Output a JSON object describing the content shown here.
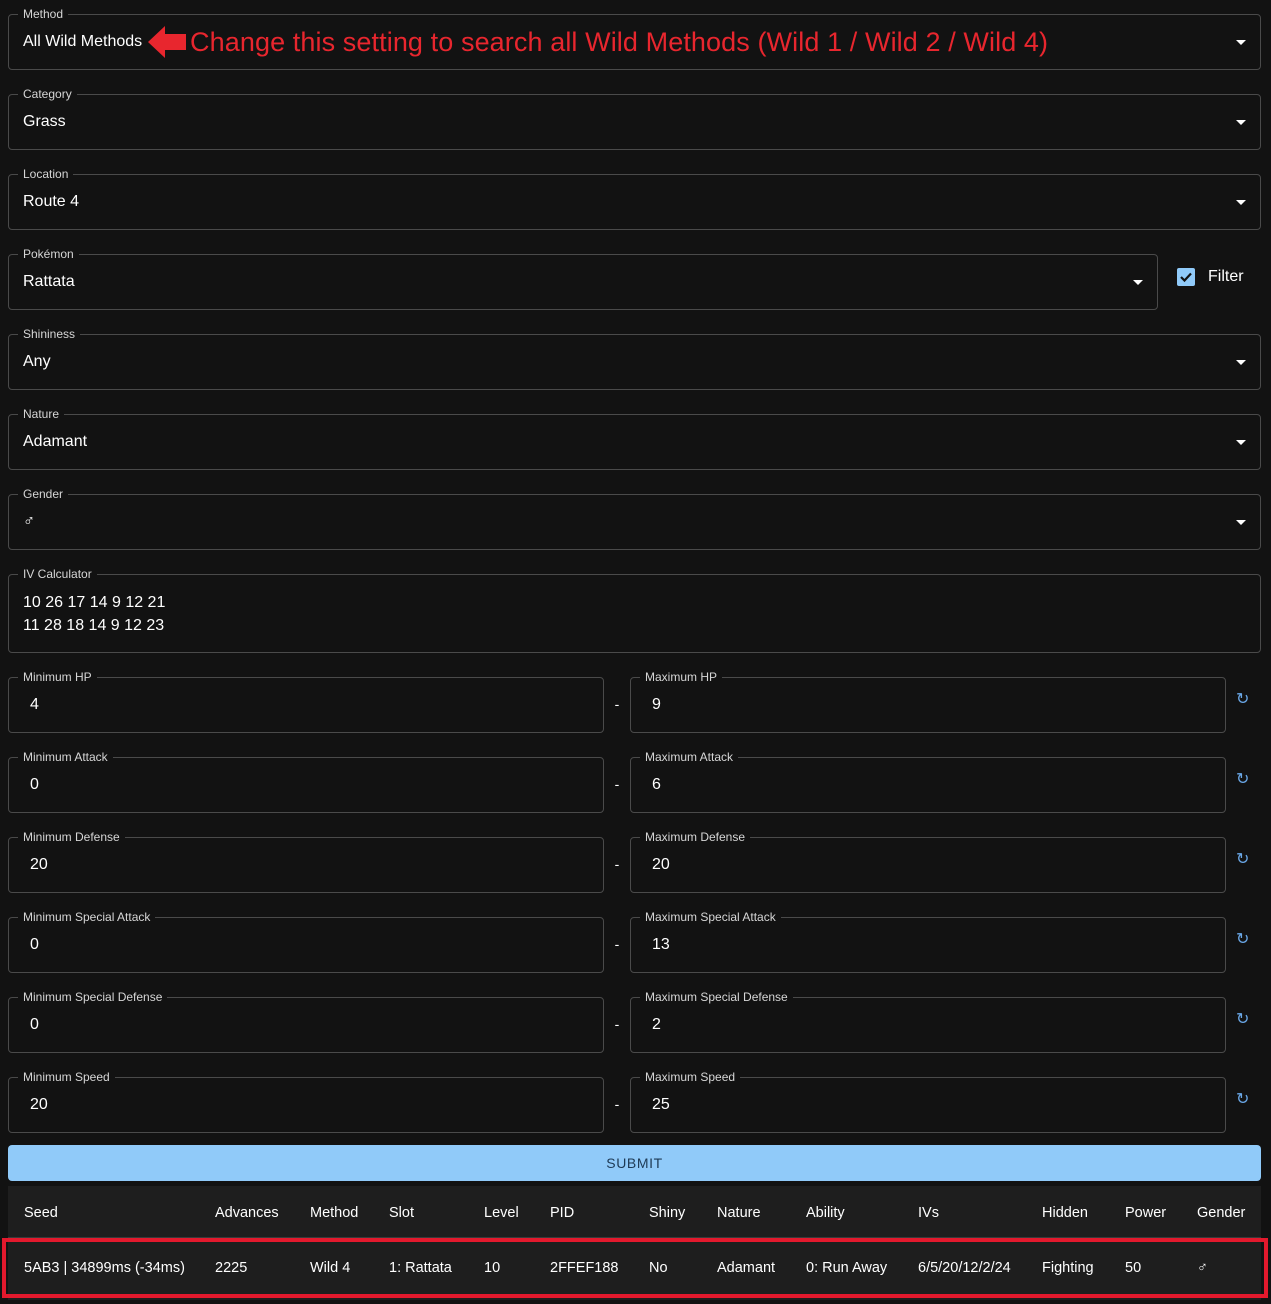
{
  "method": {
    "label": "Method",
    "value": "All Wild Methods"
  },
  "annotation": "Change this setting to search all Wild Methods (Wild 1 / Wild 2 / Wild 4)",
  "category": {
    "label": "Category",
    "value": "Grass"
  },
  "location": {
    "label": "Location",
    "value": "Route 4"
  },
  "pokemon": {
    "label": "Pokémon",
    "value": "Rattata"
  },
  "filter": {
    "label": "Filter",
    "checked": true
  },
  "shininess": {
    "label": "Shininess",
    "value": "Any"
  },
  "nature": {
    "label": "Nature",
    "value": "Adamant"
  },
  "gender": {
    "label": "Gender",
    "value": "♂"
  },
  "iv_calculator": {
    "label": "IV Calculator",
    "value": "10 26 17 14 9 12 21\n11 28 18 14 9 12 23"
  },
  "stats": [
    {
      "min_label": "Minimum HP",
      "min": "4",
      "max_label": "Maximum HP",
      "max": "9"
    },
    {
      "min_label": "Minimum Attack",
      "min": "0",
      "max_label": "Maximum Attack",
      "max": "6"
    },
    {
      "min_label": "Minimum Defense",
      "min": "20",
      "max_label": "Maximum Defense",
      "max": "20"
    },
    {
      "min_label": "Minimum Special Attack",
      "min": "0",
      "max_label": "Maximum Special Attack",
      "max": "13"
    },
    {
      "min_label": "Minimum Special Defense",
      "min": "0",
      "max_label": "Maximum Special Defense",
      "max": "2"
    },
    {
      "min_label": "Minimum Speed",
      "min": "20",
      "max_label": "Maximum Speed",
      "max": "25"
    }
  ],
  "range_separator": "-",
  "reset_glyph": "↻",
  "submit_label": "SUBMIT",
  "results": {
    "headers": [
      "Seed",
      "Advances",
      "Method",
      "Slot",
      "Level",
      "PID",
      "Shiny",
      "Nature",
      "Ability",
      "IVs",
      "Hidden",
      "Power",
      "Gender"
    ],
    "rows": [
      [
        "5AB3 | 34899ms (-34ms)",
        "2225",
        "Wild 4",
        "1: Rattata",
        "10",
        "2FFEF188",
        "No",
        "Adamant",
        "0: Run Away",
        "6/5/20/12/2/24",
        "Fighting",
        "50",
        "♂"
      ]
    ]
  },
  "colors": {
    "accent": "#90caf9",
    "annotation": "#e8262e",
    "highlight": "#e3192d",
    "background": "#121212"
  }
}
